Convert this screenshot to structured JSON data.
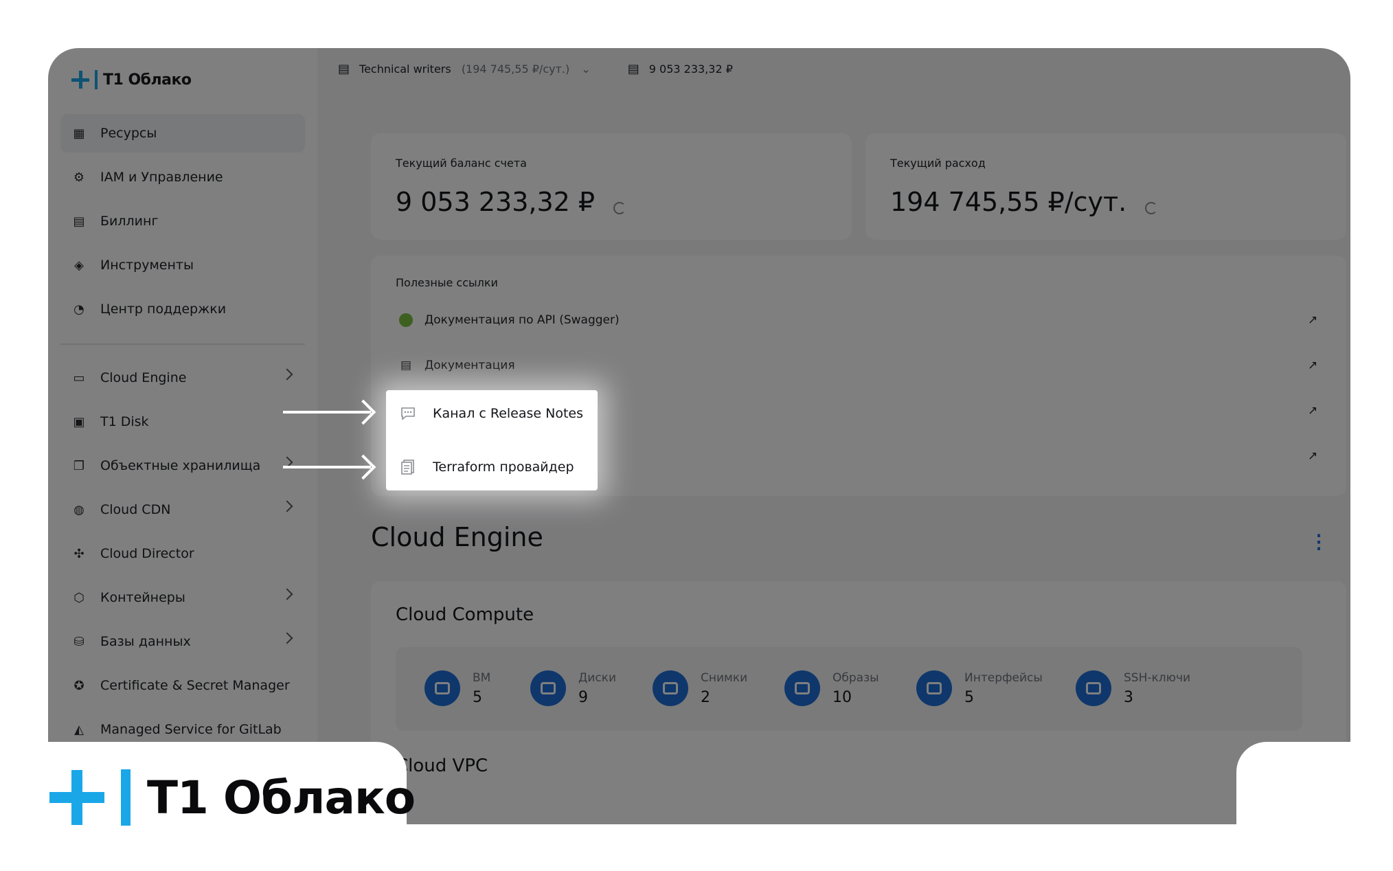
{
  "brand": {
    "name": "T1 Облако"
  },
  "topbar": {
    "project": "Technical writers",
    "project_rate": "(194 745,55 ₽/сут.)",
    "balance": "9 053 233,32 ₽"
  },
  "sidebar": {
    "items": [
      {
        "label": "Ресурсы",
        "icon": "grid-icon",
        "active": true
      },
      {
        "label": "IAM и Управление",
        "icon": "users-icon"
      },
      {
        "label": "Биллинг",
        "icon": "coins-icon"
      },
      {
        "label": "Инструменты",
        "icon": "layers-icon"
      },
      {
        "label": "Центр поддержки",
        "icon": "headset-icon"
      }
    ],
    "services": [
      {
        "label": "Cloud Engine",
        "icon": "monitor-icon",
        "chevron": true
      },
      {
        "label": "T1 Disk",
        "icon": "disk-icon",
        "chevron": false
      },
      {
        "label": "Объектные хранилища",
        "icon": "storage-icon",
        "chevron": true
      },
      {
        "label": "Cloud CDN",
        "icon": "globe-icon",
        "chevron": true
      },
      {
        "label": "Cloud Director",
        "icon": "nodes-icon",
        "chevron": false
      },
      {
        "label": "Контейнеры",
        "icon": "box-icon",
        "chevron": true
      },
      {
        "label": "Базы данных",
        "icon": "database-icon",
        "chevron": true
      },
      {
        "label": "Certificate & Secret Manager",
        "icon": "certificate-icon",
        "chevron": false
      },
      {
        "label": "Managed Service for GitLab",
        "icon": "gitlab-icon",
        "chevron": false
      }
    ]
  },
  "balance_card": {
    "label": "Текущий баланс счета",
    "value": "9 053 233,32 ₽"
  },
  "expense_card": {
    "label": "Текущий расход",
    "value": "194 745,55 ₽/сут."
  },
  "links": {
    "title": "Полезные ссылки",
    "items": [
      {
        "label": "Документация по API (Swagger)",
        "icon": "swagger-icon"
      },
      {
        "label": "Документация",
        "icon": "document-icon"
      },
      {
        "label": "Канал с Release Notes",
        "icon": "chat-icon"
      },
      {
        "label": "Terraform провайдер",
        "icon": "document-icon"
      }
    ]
  },
  "cloud_engine": {
    "title": "Cloud Engine",
    "compute_title": "Cloud Compute",
    "stats": [
      {
        "label": "ВМ",
        "value": "5"
      },
      {
        "label": "Диски",
        "value": "9"
      },
      {
        "label": "Снимки",
        "value": "2"
      },
      {
        "label": "Образы",
        "value": "10"
      },
      {
        "label": "Интерфейсы",
        "value": "5"
      },
      {
        "label": "SSH-ключи",
        "value": "3"
      }
    ],
    "vpc_title": "Cloud VPC"
  },
  "colors": {
    "accent": "#1aa7e8",
    "stat_icon": "#1f6fd6"
  }
}
